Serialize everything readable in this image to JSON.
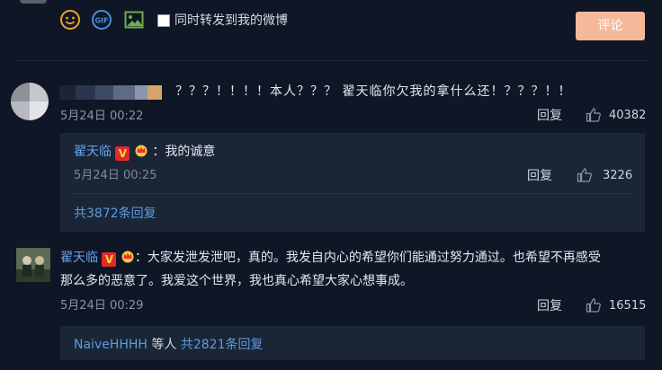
{
  "composer": {
    "forward_label": "同时转发到我的微博",
    "submit_label": "评论",
    "gif_label": "GIF"
  },
  "comments": [
    {
      "text": "？？？！！！！本人？？？ 翟天临你欠我的拿什么还！？？？！！",
      "date": "5月24日 00:22",
      "reply_label": "回复",
      "likes": "40382",
      "replies": [
        {
          "author": "翟天临",
          "text": "：我的诚意",
          "date": "5月24日 00:25",
          "reply_label": "回复",
          "likes": "3226"
        }
      ],
      "more_replies": "共3872条回复"
    },
    {
      "author": "翟天临",
      "text_line1": "：大家发泄发泄吧，真的。我发自内心的希望你们能通过努力通过。也希望不再感受",
      "text_line2": "那么多的恶意了。我爱这个世界，我也真心希望大家心想事成。",
      "date": "5月24日 00:29",
      "reply_label": "回复",
      "likes": "16515",
      "reply_user": "NaiveHHHH",
      "reply_etc": " 等人 ",
      "more_replies": "共2821条回复"
    }
  ],
  "badges": {
    "v": "V"
  },
  "colors": {
    "background": "#0f1626",
    "panel": "#1a2536",
    "link": "#5d9be0",
    "button": "#f5b99a"
  },
  "icons": [
    "emoji-icon",
    "gif-icon",
    "image-icon",
    "like-icon",
    "crown-icon"
  ]
}
